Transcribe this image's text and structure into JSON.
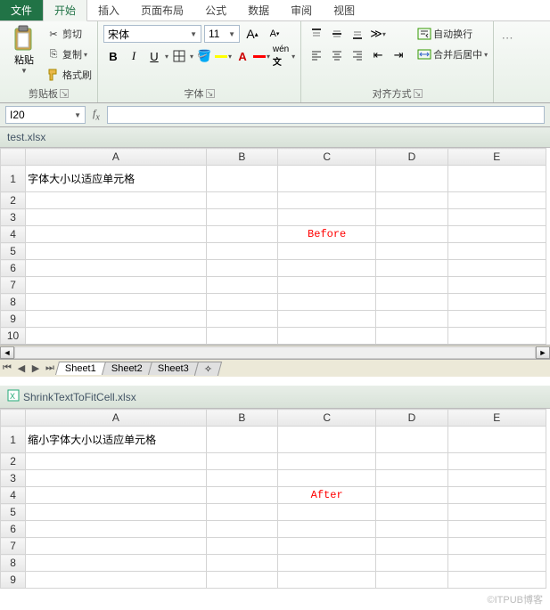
{
  "tabs": {
    "file": "文件",
    "start": "开始",
    "insert": "插入",
    "layout": "页面布局",
    "formula": "公式",
    "data": "数据",
    "review": "审阅",
    "view": "视图"
  },
  "clipboard": {
    "paste": "粘贴",
    "cut": "剪切",
    "copy": "复制",
    "format_painter": "格式刷",
    "group": "剪贴板"
  },
  "font": {
    "name": "宋体",
    "size": "11",
    "group": "字体",
    "bold": "B",
    "italic": "I",
    "underline": "U"
  },
  "align": {
    "wrap": "自动换行",
    "merge": "合并后居中",
    "group": "对齐方式"
  },
  "namebox": "I20",
  "doc1": {
    "title": "test.xlsx",
    "cols": [
      "A",
      "B",
      "C",
      "D",
      "E"
    ],
    "rows": [
      "1",
      "2",
      "3",
      "4",
      "5",
      "6",
      "7",
      "8",
      "9",
      "10"
    ],
    "a1": "字体大小以适应单元格",
    "label": "Before",
    "sheets": [
      "Sheet1",
      "Sheet2",
      "Sheet3"
    ]
  },
  "doc2": {
    "title": "ShrinkTextToFitCell.xlsx",
    "cols": [
      "A",
      "B",
      "C",
      "D",
      "E"
    ],
    "rows": [
      "1",
      "2",
      "3",
      "4",
      "5",
      "6",
      "7",
      "8",
      "9"
    ],
    "a1": "缩小字体大小以适应单元格",
    "label": "After"
  },
  "watermark": "©ITPUB博客"
}
